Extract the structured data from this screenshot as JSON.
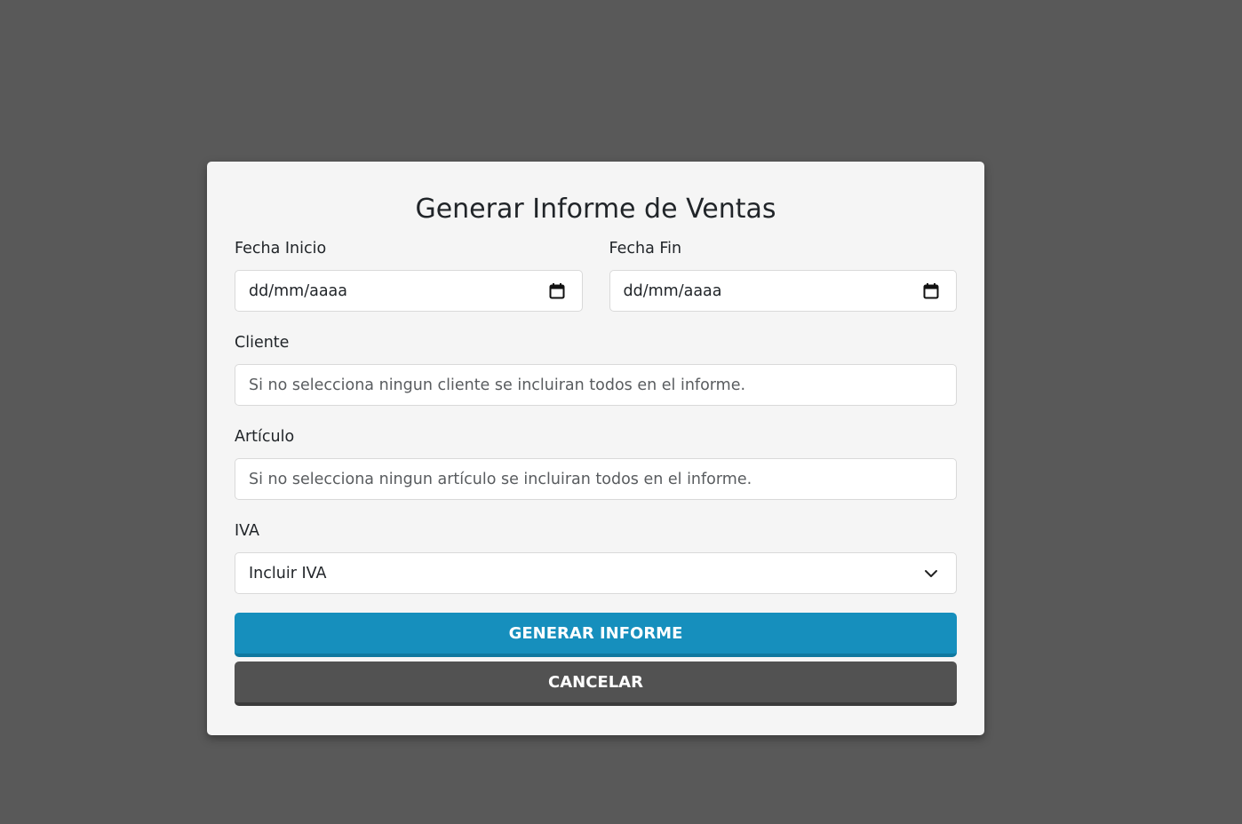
{
  "dialog": {
    "title": "Generar Informe de Ventas"
  },
  "fecha_inicio": {
    "label": "Fecha Inicio",
    "value": "dd/mm/aaaa"
  },
  "fecha_fin": {
    "label": "Fecha Fin",
    "value": "dd/mm/aaaa"
  },
  "cliente": {
    "label": "Cliente",
    "placeholder": "Si no selecciona ningun cliente se incluiran todos en el informe."
  },
  "articulo": {
    "label": "Artículo",
    "placeholder": "Si no selecciona ningun artículo se incluiran todos en el informe."
  },
  "iva": {
    "label": "IVA",
    "selected": "Incluir IVA"
  },
  "buttons": {
    "generate": "GENERAR INFORME",
    "cancel": "CANCELAR"
  },
  "colors": {
    "backdrop": "#595959",
    "panel": "#f5f5f5",
    "primary": "#168fbd",
    "secondary": "#525252"
  },
  "icons": {
    "date": "calendar-icon",
    "select": "chevron-down-icon"
  }
}
